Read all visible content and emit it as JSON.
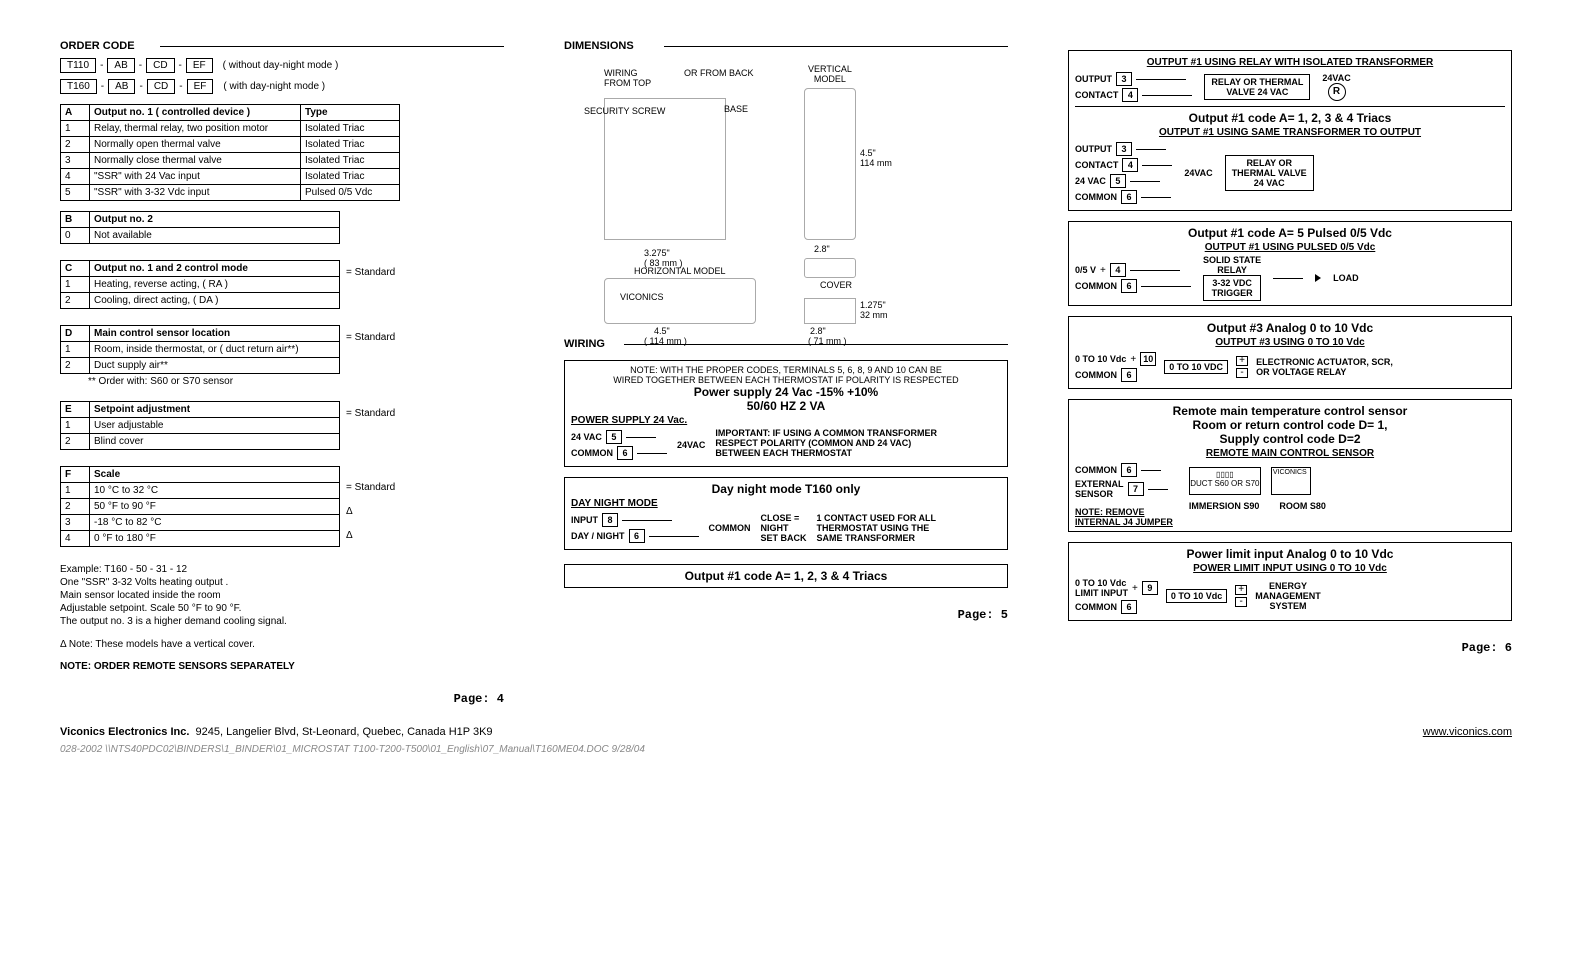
{
  "page4": {
    "order_code_title": "ORDER CODE",
    "code_rows": [
      {
        "parts": [
          "T110",
          "AB",
          "CD",
          "EF"
        ],
        "note": "( without day-night mode )"
      },
      {
        "parts": [
          "T160",
          "AB",
          "CD",
          "EF"
        ],
        "note": "( with day-night mode )"
      }
    ],
    "tableA": {
      "headers": [
        "A",
        "Output no. 1 ( controlled device )",
        "Type"
      ],
      "rows": [
        [
          "1",
          "Relay, thermal relay, two position motor",
          "Isolated  Triac"
        ],
        [
          "2",
          "Normally open thermal valve",
          "Isolated  Triac"
        ],
        [
          "3",
          "Normally close thermal valve",
          "Isolated  Triac"
        ],
        [
          "4",
          "\"SSR\" with 24 Vac input",
          "Isolated  Triac"
        ],
        [
          "5",
          "\"SSR\" with 3-32 Vdc input",
          "Pulsed 0/5 Vdc"
        ]
      ]
    },
    "tableB": {
      "headers": [
        "B",
        "Output no. 2"
      ],
      "rows": [
        [
          "0",
          "Not available"
        ]
      ]
    },
    "tableC": {
      "headers": [
        "C",
        "Output no. 1 and 2 control mode"
      ],
      "rows": [
        [
          "1",
          "Heating,  reverse acting,  ( RA )"
        ],
        [
          "2",
          "Cooling,  direct acting,    ( DA )"
        ]
      ],
      "side": "= Standard"
    },
    "tableD": {
      "headers": [
        "D",
        "Main control sensor location"
      ],
      "rows": [
        [
          "1",
          "Room, inside thermostat, or ( duct return air**)"
        ],
        [
          "2",
          "Duct supply air**"
        ]
      ],
      "side": "= Standard",
      "footnote": "** Order with: S60 or S70 sensor"
    },
    "tableE": {
      "headers": [
        "E",
        "Setpoint adjustment"
      ],
      "rows": [
        [
          "1",
          "User adjustable"
        ],
        [
          "2",
          "Blind cover"
        ]
      ],
      "side": "= Standard"
    },
    "tableF": {
      "headers": [
        "F",
        "Scale"
      ],
      "rows": [
        [
          "1",
          "10 °C to 32 °C",
          "= Standard"
        ],
        [
          "2",
          "50 °F to 90 °F",
          ""
        ],
        [
          "3",
          "-18 °C to 82 °C",
          "Δ"
        ],
        [
          "4",
          "0 °F to 180 °F",
          "Δ"
        ]
      ]
    },
    "example_block": [
      "Example:  T160 - 50 - 31 - 12",
      "One \"SSR\" 3-32 Volts heating output .",
      "Main sensor located inside the room",
      "Adjustable setpoint. Scale 50 °F to 90 °F.",
      "The output no. 3 is a higher demand cooling signal."
    ],
    "delta_note": "Δ Note: These models have a vertical cover.",
    "order_sensors_note": "NOTE: ORDER REMOTE SENSORS SEPARATELY",
    "page_num": "Page: 4"
  },
  "page5": {
    "dimensions_title": "DIMENSIONS",
    "labels": {
      "wiring_from_top": "WIRING\nFROM TOP",
      "or_from_back": "OR FROM BACK",
      "security_screw": "SECURITY SCREW",
      "base": "BASE",
      "vertical_model": "VERTICAL\nMODEL",
      "viconics": "VICONICS",
      "horizontal_model": "HORIZONTAL MODEL",
      "cover": "COVER",
      "d1": "3.275\"",
      "d1mm": "( 83 mm )",
      "d2": "4.5\"",
      "d2mm": "( 114 mm )",
      "d3": "2.8\"",
      "d3mm": "( 71 mm )",
      "d4": "1.275\"",
      "d4mm": "32 mm",
      "d5": "4.5\"",
      "d5mm": "114 mm"
    },
    "wiring_title": "WIRING",
    "note_top": "NOTE: WITH THE PROPER CODES, TERMINALS 5, 6, 8, 9 AND 10 CAN BE\nWIRED TOGETHER BETWEEN EACH THERMOSTAT IF POLARITY IS RESPECTED",
    "power_supply": "Power supply 24 Vac -15% +10%",
    "power_hz": "50/60 HZ 2 VA",
    "ps_sub": "POWER SUPPLY 24 Vac.",
    "t24vac": "24 VAC",
    "t24vac_side": "24VAC",
    "tcommon": "COMMON",
    "ps_important": "IMPORTANT: IF USING A COMMON TRANSFORMER\nRESPECT POLARITY (COMMON AND 24 VAC)\nBETWEEN EACH THERMOSTAT",
    "dn_title": "Day night mode T160 only",
    "dn_sub": "DAY NIGHT MODE",
    "dn_input": "INPUT",
    "dn_daynight": "DAY / NIGHT",
    "dn_common": "COMMON",
    "dn_close": "CLOSE =\nNIGHT\nSET BACK",
    "dn_note": "1 CONTACT USED FOR ALL\nTHERMOSTAT USING THE\nSAME TRANSFORMER",
    "triac_line": "Output #1 code A= 1, 2, 3 & 4 Triacs",
    "page_num": "Page: 5"
  },
  "page6": {
    "box1": {
      "sub": "OUTPUT #1 USING RELAY WITH ISOLATED TRANSFORMER",
      "output": "OUTPUT",
      "contact": "CONTACT",
      "relay_box": "RELAY OR THERMAL\nVALVE 24 VAC",
      "r": "R",
      "v24": "24VAC"
    },
    "box2": {
      "title": "Output #1 code A= 1, 2, 3 & 4 Triacs",
      "sub": "OUTPUT #1 USING SAME TRANSFORMER TO OUTPUT",
      "output": "OUTPUT",
      "contact": "CONTACT",
      "v24": "24 VAC",
      "common": "COMMON",
      "v24_side": "24VAC",
      "relay_box": "RELAY OR\nTHERMAL VALVE\n24 VAC"
    },
    "box3": {
      "title": "Output #1 code A= 5 Pulsed 0/5 Vdc",
      "sub": "OUTPUT #1 USING PULSED 0/5 Vdc",
      "out05": "0/5 V",
      "common": "COMMON",
      "ssr": "SOLID STATE\nRELAY",
      "vdc": "3-32 VDC\nTRIGGER",
      "load": "LOAD"
    },
    "box4": {
      "title": "Output #3 Analog 0 to 10 Vdc",
      "sub": "OUTPUT #3 USING 0 TO 10 Vdc",
      "in": "0 TO 10 Vdc",
      "common": "COMMON",
      "box": "0 TO 10 VDC",
      "act": "ELECTRONIC ACTUATOR, SCR,\nOR VOLTAGE RELAY"
    },
    "box5": {
      "title1": "Remote main temperature control sensor",
      "title2": "Room or return control code D= 1,",
      "title3": "Supply control code D=2",
      "sub": "REMOTE MAIN CONTROL SENSOR",
      "common": "COMMON",
      "ext": "EXTERNAL\nSENSOR",
      "duct": "DUCT S60 OR S70",
      "viconics": "VICONICS",
      "imm": "IMMERSION S90",
      "room": "ROOM S80",
      "note": "NOTE: REMOVE\nINTERNAL J4 JUMPER"
    },
    "box6": {
      "title": "Power limit input Analog 0 to 10 Vdc",
      "sub": "POWER LIMIT INPUT USING 0 TO 10 Vdc",
      "in": "0 TO 10 Vdc\nLIMIT INPUT",
      "common": "COMMON",
      "box": "0 TO 10 Vdc",
      "ems": "ENERGY\nMANAGEMENT\nSYSTEM"
    },
    "page_num": "Page: 6"
  },
  "footer": {
    "company": "Viconics Electronics Inc.",
    "addr": "9245, Langelier Blvd, St-Leonard, Quebec, Canada H1P 3K9",
    "url": "www.viconics.com",
    "docpath": "028-2002 \\\\NTS40PDC02\\BINDERS\\1_BINDER\\01_MICROSTAT  T100-T200-T500\\01_English\\07_Manual\\T160ME04.DOC  9/28/04"
  }
}
